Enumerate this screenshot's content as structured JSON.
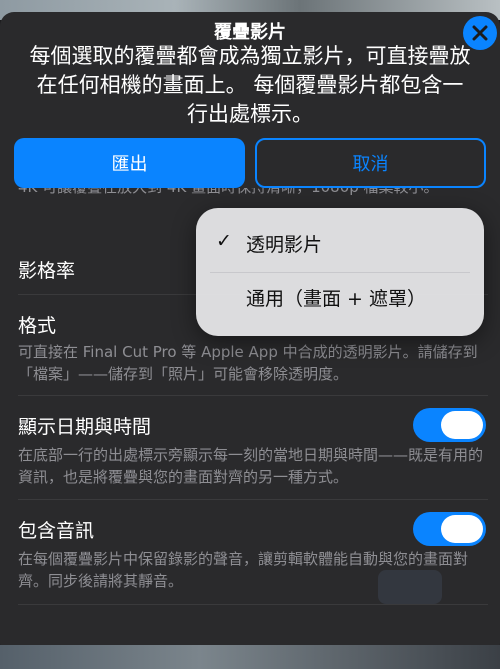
{
  "dialog": {
    "title": "覆疊影片",
    "subtitle": "每個選取的覆疊都會成為獨立影片，可直接疊放在任何相機的畫面上。 每個覆疊影片都包含一行出處標示。",
    "close_icon": "close-icon"
  },
  "buttons": {
    "export_label": "匯出",
    "cancel_label": "取消"
  },
  "clipped_text": "4K 可讓覆疊在放大到 4K 畫面時保持清晰，1080p 檔案較小。",
  "frame_rate": {
    "label": "影格率"
  },
  "format": {
    "label": "格式",
    "description": "可直接在 Final Cut Pro 等 Apple App 中合成的透明影片。請儲存到「檔案」——儲存到「照片」可能會移除透明度。"
  },
  "show_datetime": {
    "label": "顯示日期與時間",
    "description": "在底部一行的出處標示旁顯示每一刻的當地日期與時間——既是有用的資訊，也是將覆疊與您的畫面對齊的另一種方式。",
    "enabled": true
  },
  "include_audio": {
    "label": "包含音訊",
    "description": "在每個覆疊影片中保留錄影的聲音，讓剪輯軟體能自動與您的畫面對齊。同步後請將其靜音。",
    "enabled": true
  },
  "format_menu": {
    "options": [
      {
        "label": "透明影片",
        "selected": true,
        "check": "✓"
      },
      {
        "label": "通用（畫面 + 遮罩）",
        "selected": false,
        "check": ""
      }
    ]
  },
  "colors": {
    "accent": "#0a84ff",
    "sheet": "#2a2a2c",
    "secondary_text": "#8e8e93"
  }
}
